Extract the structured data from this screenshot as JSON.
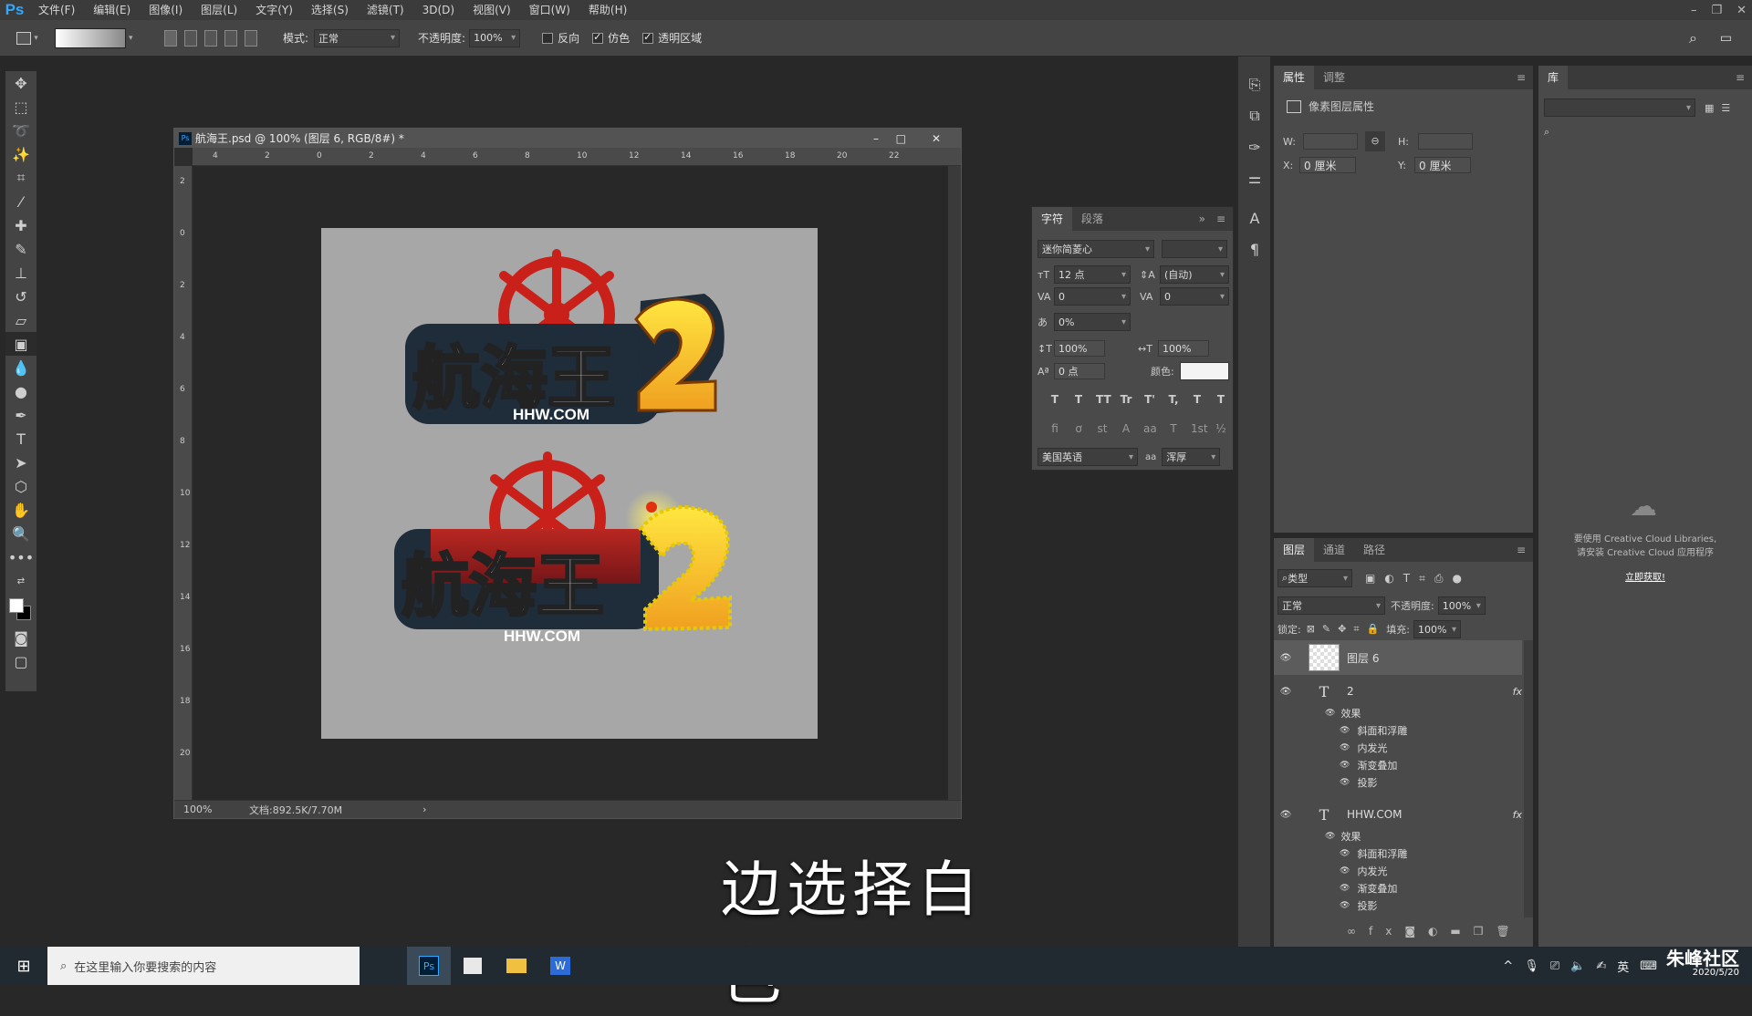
{
  "menubar": {
    "logo": "Ps",
    "items": [
      "文件(F)",
      "编辑(E)",
      "图像(I)",
      "图层(L)",
      "文字(Y)",
      "选择(S)",
      "滤镜(T)",
      "3D(D)",
      "视图(V)",
      "窗口(W)",
      "帮助(H)"
    ]
  },
  "options": {
    "mode_label": "模式:",
    "mode_value": "正常",
    "opacity_label": "不透明度:",
    "opacity_value": "100%",
    "reverse_label": "反向",
    "dither_label": "仿色",
    "transparency_label": "透明区域"
  },
  "document": {
    "title": "航海王.psd @ 100% (图层 6, RGB/8#) *",
    "zoom": "100%",
    "doc_info": "文档:892.5K/7.70M",
    "ruler_h": [
      "4",
      "2",
      "0",
      "2",
      "4",
      "6",
      "8",
      "10",
      "12",
      "14",
      "16",
      "18",
      "20",
      "22"
    ],
    "ruler_v": [
      "2",
      "0",
      "2",
      "4",
      "6",
      "8",
      "10",
      "12",
      "14",
      "16",
      "18",
      "20"
    ],
    "logo_text": "航海王",
    "logo_num": "2",
    "logo_url": "HHW.COM"
  },
  "character": {
    "tab1": "字符",
    "tab2": "段落",
    "font": "迷你简菱心",
    "size": "12 点",
    "leading": "(自动)",
    "kerning": "0",
    "tracking": "0",
    "scale_pct": "0%",
    "vscale": "100%",
    "hscale": "100%",
    "baseline": "0 点",
    "color_label": "颜色:",
    "style_row1": [
      "T",
      "T",
      "TT",
      "Tr",
      "T'",
      "T,",
      "T",
      "T"
    ],
    "style_row2": [
      "fi",
      "ơ",
      "st",
      "A",
      "aa",
      "T",
      "1st",
      "½"
    ],
    "language": "美国英语",
    "aa": "浑厚",
    "aa_label": "aa"
  },
  "properties": {
    "tab1": "属性",
    "tab2": "调整",
    "header": "像素图层属性",
    "w_label": "W:",
    "h_label": "H:",
    "x_label": "X:",
    "x_value": "0 厘米",
    "y_label": "Y:",
    "y_value": "0 厘米"
  },
  "library": {
    "tab": "库",
    "msg1": "要使用 Creative Cloud Libraries,",
    "msg2": "请安装 Creative Cloud 应用程序",
    "link": "立即获取!"
  },
  "layers": {
    "tab1": "图层",
    "tab2": "通道",
    "tab3": "路径",
    "filter": "类型",
    "blend": "正常",
    "opacity_label": "不透明度:",
    "opacity": "100%",
    "lock_label": "锁定:",
    "fill_label": "填充:",
    "fill": "100%",
    "items": [
      {
        "name": "图层 6",
        "type": "pixel"
      },
      {
        "name": "2",
        "type": "text",
        "fx": "fx",
        "effects_label": "效果",
        "effects": [
          "斜面和浮雕",
          "内发光",
          "渐变叠加",
          "投影"
        ]
      },
      {
        "name": "HHW.COM",
        "type": "text",
        "fx": "fx",
        "effects_label": "效果",
        "effects": [
          "斜面和浮雕",
          "内发光",
          "渐变叠加",
          "投影"
        ]
      }
    ]
  },
  "subtitle": "边选择白色",
  "taskbar": {
    "search_placeholder": "在这里输入你要搜索的内容",
    "lang": "英",
    "watermark": "朱峰社区",
    "date": "2020/5/20"
  }
}
